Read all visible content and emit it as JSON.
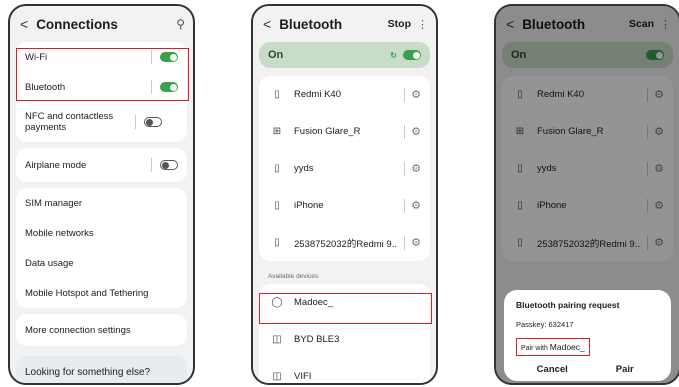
{
  "screen1": {
    "title": "Connections",
    "back": "<",
    "search_icon": "search-icon",
    "rows_top": [
      {
        "label": "Wi-Fi",
        "toggle": "on"
      },
      {
        "label": "Bluetooth",
        "toggle": "on"
      },
      {
        "label": "NFC and contactless payments",
        "toggle": "off"
      }
    ],
    "airplane": {
      "label": "Airplane mode",
      "toggle": "off"
    },
    "mid_items": [
      "SIM manager",
      "Mobile networks",
      "Data usage",
      "Mobile Hotspot and Tethering"
    ],
    "more": "More connection settings",
    "looking": "Looking for something else?"
  },
  "screen2": {
    "title": "Bluetooth",
    "action": "Stop",
    "on_label": "On",
    "paired": [
      {
        "name": "Redmi K40",
        "icon": "phone-icon"
      },
      {
        "name": "Fusion Glare_R",
        "icon": "controller-icon"
      },
      {
        "name": "yyds",
        "icon": "phone-icon"
      },
      {
        "name": "iPhone",
        "icon": "phone-icon"
      },
      {
        "name": "2538752032的Redmi 9..",
        "icon": "phone-icon"
      }
    ],
    "available_label": "Available devices",
    "available": [
      {
        "name": "Madoec_",
        "icon": "watch-icon"
      },
      {
        "name": "BYD BLE3",
        "icon": "headset-icon"
      },
      {
        "name": "VIFI",
        "icon": "headset-icon"
      }
    ]
  },
  "screen3": {
    "title": "Bluetooth",
    "action": "Scan",
    "on_label": "On",
    "paired": [
      {
        "name": "Redmi K40",
        "icon": "phone-icon"
      },
      {
        "name": "Fusion Glare_R",
        "icon": "controller-icon"
      },
      {
        "name": "yyds",
        "icon": "phone-icon"
      },
      {
        "name": "iPhone",
        "icon": "phone-icon"
      },
      {
        "name": "2538752032的Redmi 9..",
        "icon": "phone-icon"
      }
    ],
    "dialog": {
      "title": "Bluetooth pairing request",
      "passkey": "Passkey: 632417",
      "pair_with": "Pair with",
      "device": "Madoec_",
      "cancel": "Cancel",
      "pair": "Pair"
    }
  },
  "colors": {
    "accent_green": "#38a14a",
    "highlight_red": "#d6202a"
  }
}
